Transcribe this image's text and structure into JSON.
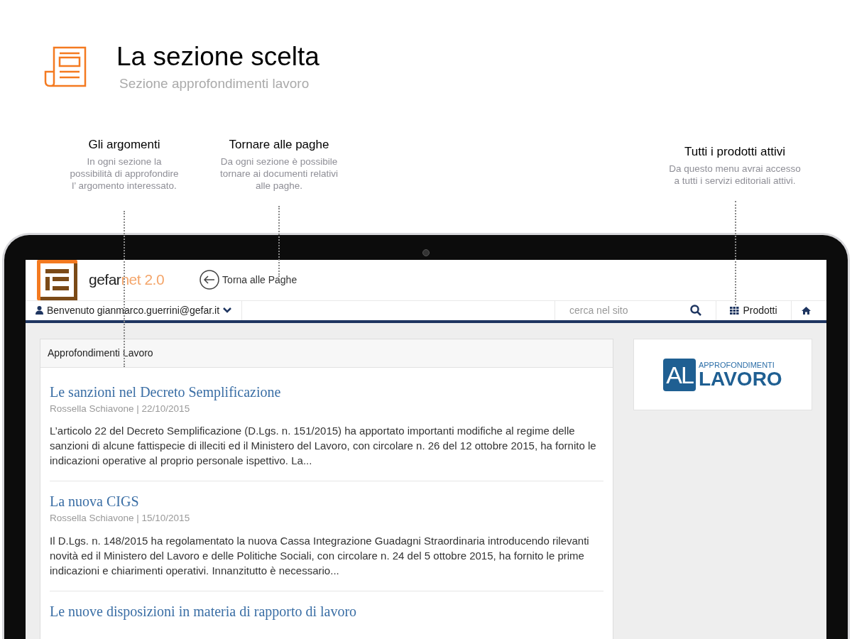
{
  "header": {
    "title": "La sezione scelta",
    "subtitle": "Sezione approfondimenti lavoro"
  },
  "callouts": [
    {
      "title": "Gli argomenti",
      "description": [
        "In ogni sezione la",
        "possibilità di approfondire",
        "l’ argomento interessato."
      ]
    },
    {
      "title": "Tornare alle paghe",
      "description": [
        "Da ogni sezione è possibile",
        "tornare ai documenti relativi",
        "alle paghe."
      ]
    },
    {
      "title": "Tutti i prodotti attivi",
      "description": [
        "Da questo menu avrai accesso",
        "a tutti i servizi editoriali attivi."
      ]
    }
  ],
  "site": {
    "logo": {
      "name": "gefar",
      "suffix": "net 2.0"
    },
    "back_link": "Torna alle Paghe",
    "user_menu": "Benvenuto gianmarco.guerrini@gefar.it",
    "search": {
      "placeholder": "cerca nel sito"
    },
    "products": "Prodotti",
    "panel_title": "Approfondimenti Lavoro",
    "articles": [
      {
        "title": "Le sanzioni nel Decreto Semplificazione",
        "meta": "Rossella Schiavone | 22/10/2015",
        "body": "L’articolo 22 del Decreto Semplificazione (D.Lgs. n. 151/2015) ha apportato importanti modifiche al regime delle sanzioni di alcune fattispecie di illeciti ed il Ministero del Lavoro, con circolare n. 26 del 12 ottobre 2015, ha fornito le indicazioni operative al proprio personale ispettivo. La..."
      },
      {
        "title": "La nuova CIGS",
        "meta": "Rossella Schiavone | 15/10/2015",
        "body": "Il D.Lgs. n. 148/2015 ha regolamentato la nuova Cassa Integrazione Guadagni Straordinaria introducendo rilevanti novità ed il Ministero del Lavoro e delle Politiche Sociali, con circolare n. 24 del 5 ottobre 2015, ha fornito le prime indicazioni e chiarimenti operativi. Innanzitutto è necessario..."
      },
      {
        "title": "Le nuove disposizioni in materia di rapporto di lavoro"
      }
    ],
    "section_logo": {
      "mark": "AL",
      "top": "APPROFONDIMENTI",
      "bottom": "LAVORO"
    }
  }
}
